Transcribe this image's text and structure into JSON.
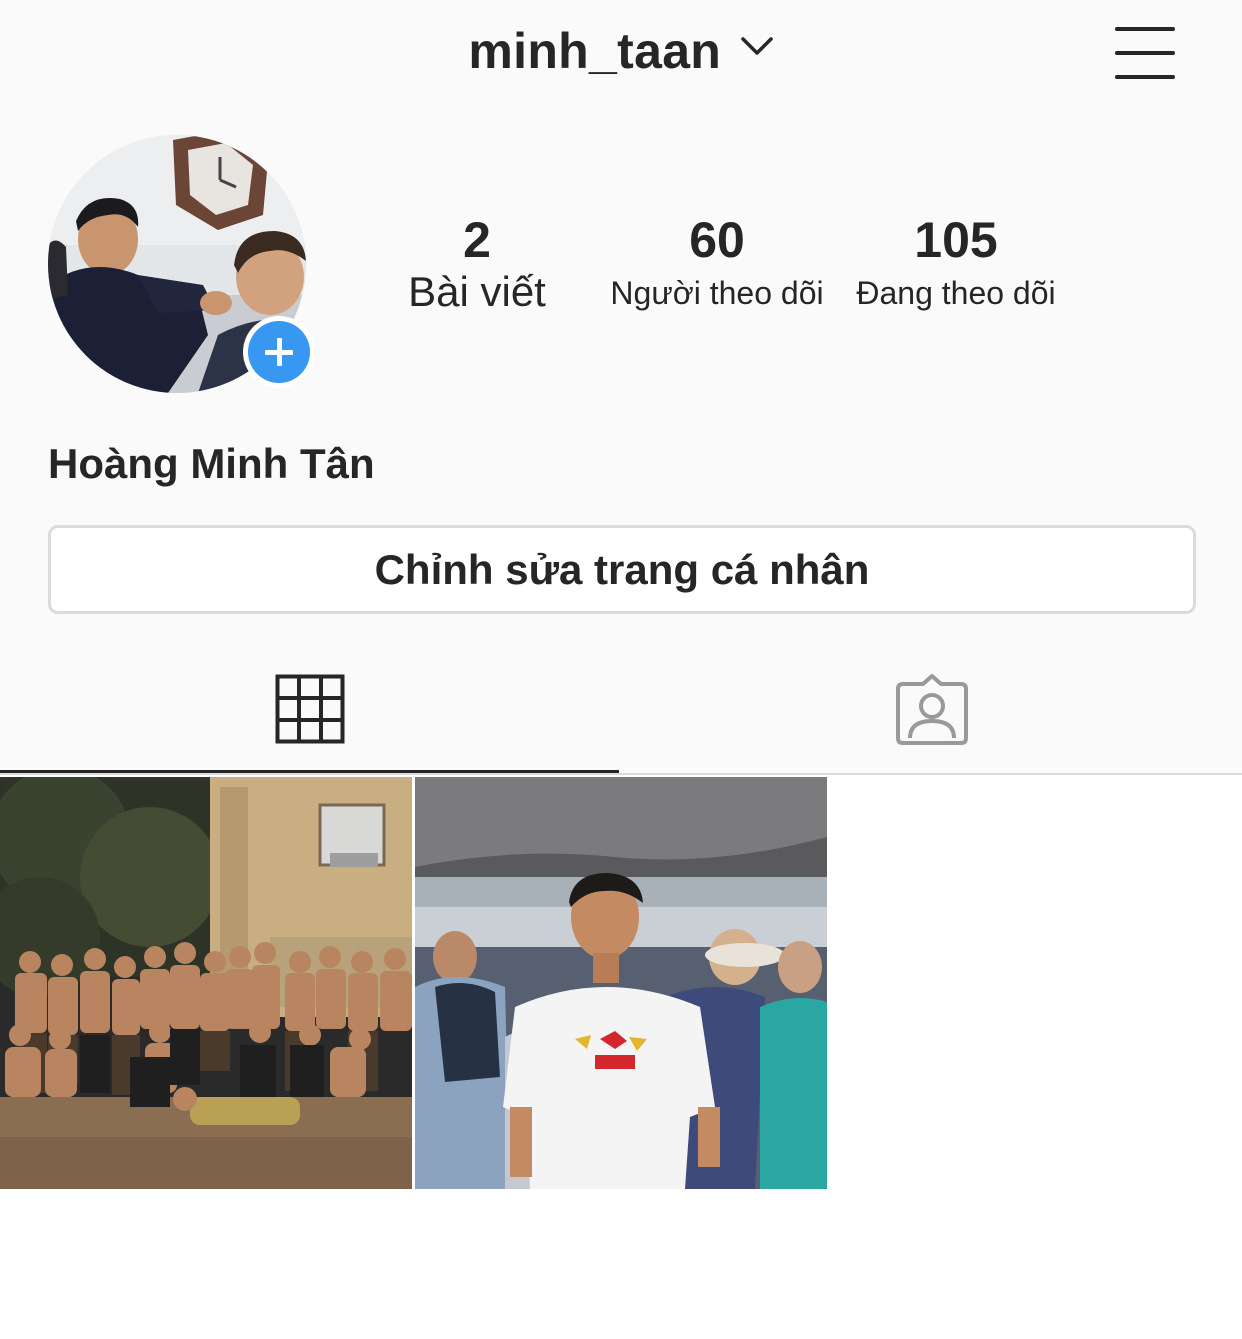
{
  "header": {
    "username": "minh_taan",
    "dropdown_icon": "chevron-down-icon",
    "menu_icon": "hamburger-menu-icon"
  },
  "profile": {
    "full_name": "Hoàng Minh Tân",
    "stats": {
      "posts": {
        "value": "2",
        "label": "Bài viết"
      },
      "followers": {
        "value": "60",
        "label": "Người theo dõi"
      },
      "following": {
        "value": "105",
        "label": "Đang theo dõi"
      }
    },
    "edit_button_label": "Chỉnh sửa trang cá nhân",
    "add_story_icon": "plus-icon"
  },
  "tabs": [
    {
      "icon": "grid-icon",
      "active": true
    },
    {
      "icon": "tagged-person-icon",
      "active": false
    }
  ],
  "posts": [
    {
      "image": "group-photo-night"
    },
    {
      "image": "man-red-bull-shirt"
    }
  ],
  "colors": {
    "accent": "#3897f0",
    "text": "#262626",
    "border": "#dbdbdb",
    "background": "#fafafa"
  }
}
